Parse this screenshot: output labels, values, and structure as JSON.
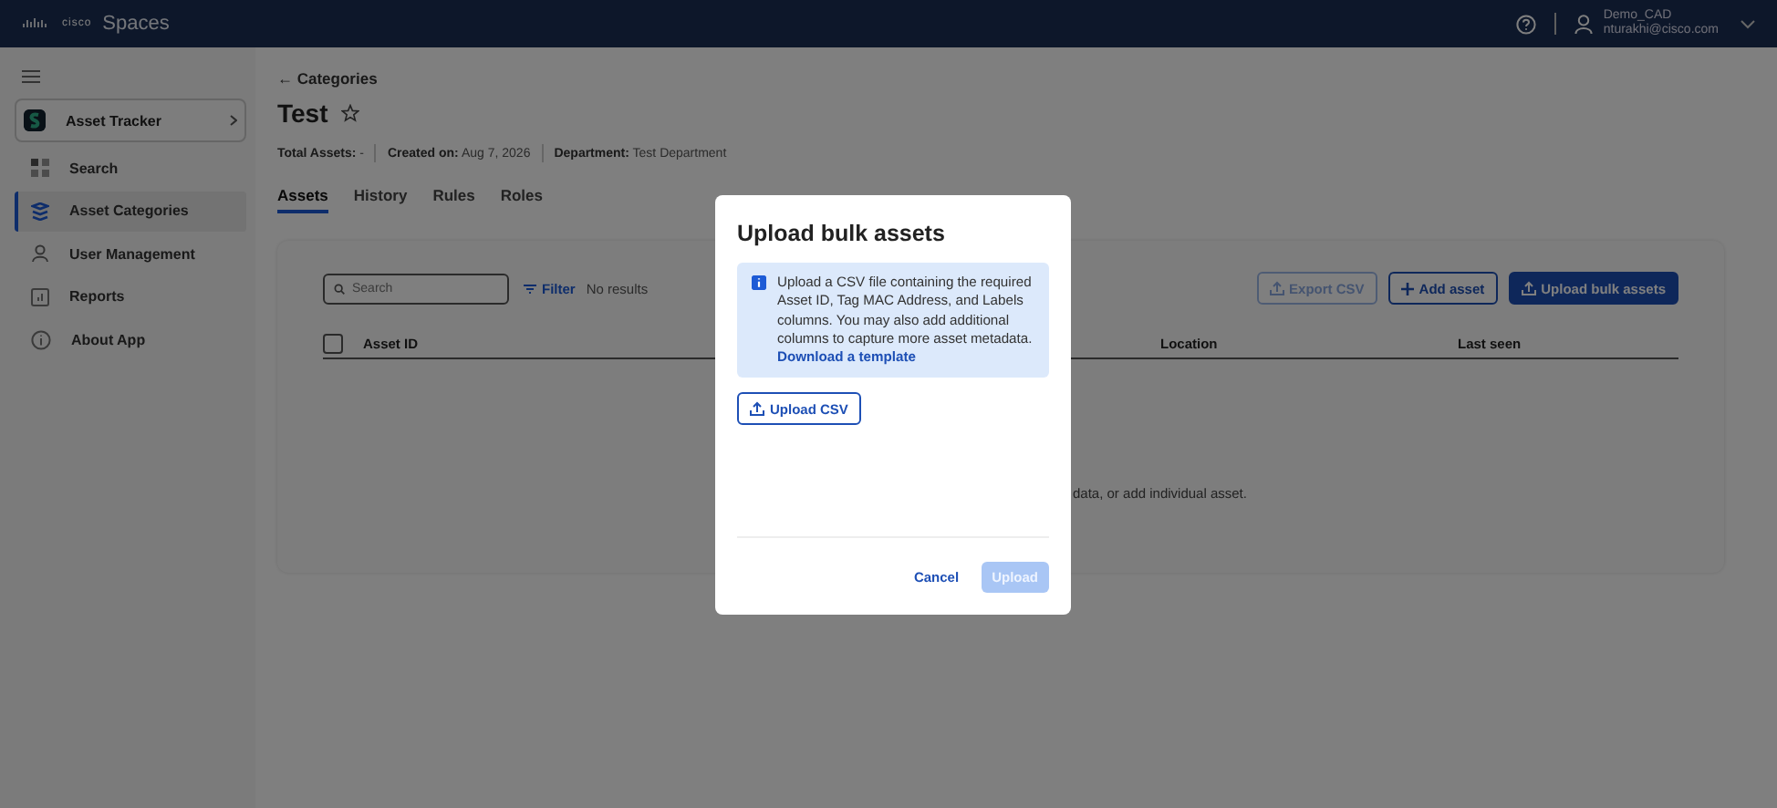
{
  "header": {
    "logo": "cisco",
    "app_name": "Spaces",
    "user": {
      "name": "Demo_CAD",
      "email": "nturakhi@cisco.com"
    }
  },
  "sidebar": {
    "app": {
      "name": "Asset Tracker"
    },
    "items": [
      {
        "label": "Search",
        "selected": false
      },
      {
        "label": "Asset Categories",
        "selected": true
      },
      {
        "label": "User Management",
        "selected": false
      },
      {
        "label": "Reports",
        "selected": false
      },
      {
        "label": "About App",
        "selected": false
      }
    ]
  },
  "page": {
    "back_link": "← Categories",
    "title": "Test",
    "meta": [
      {
        "label": "Total Assets:",
        "value": "-"
      },
      {
        "label": "Created on:",
        "value": "Aug 7, 2026"
      },
      {
        "label": "Department:",
        "value": "Test Department"
      }
    ],
    "tabs": [
      {
        "label": "Assets",
        "selected": true
      },
      {
        "label": "History",
        "selected": false
      },
      {
        "label": "Rules",
        "selected": false
      },
      {
        "label": "Roles",
        "selected": false
      }
    ]
  },
  "card": {
    "search_placeholder": "Search",
    "filter": "Filter",
    "result_count": "No results",
    "buttons": [
      {
        "label": "Export CSV",
        "kind": "outline",
        "disabled": true
      },
      {
        "label": "Add asset",
        "kind": "outline",
        "disabled": false
      },
      {
        "label": "Upload bulk assets",
        "kind": "primary",
        "disabled": false
      }
    ],
    "select_all_checked": false,
    "columns": [
      "Asset ID",
      "Location",
      "Last seen"
    ],
    "empty_message": "data, or add individual asset."
  },
  "dialog": {
    "title": "Upload bulk assets",
    "info": "Upload a CSV file containing the required Asset ID, Tag MAC Address, and Labels columns. You may also add additional columns to capture more asset metadata.",
    "info_link": "Download a template",
    "upload_button": "Upload CSV",
    "cancel": "Cancel",
    "submit": {
      "label": "Upload",
      "disabled": true
    }
  }
}
